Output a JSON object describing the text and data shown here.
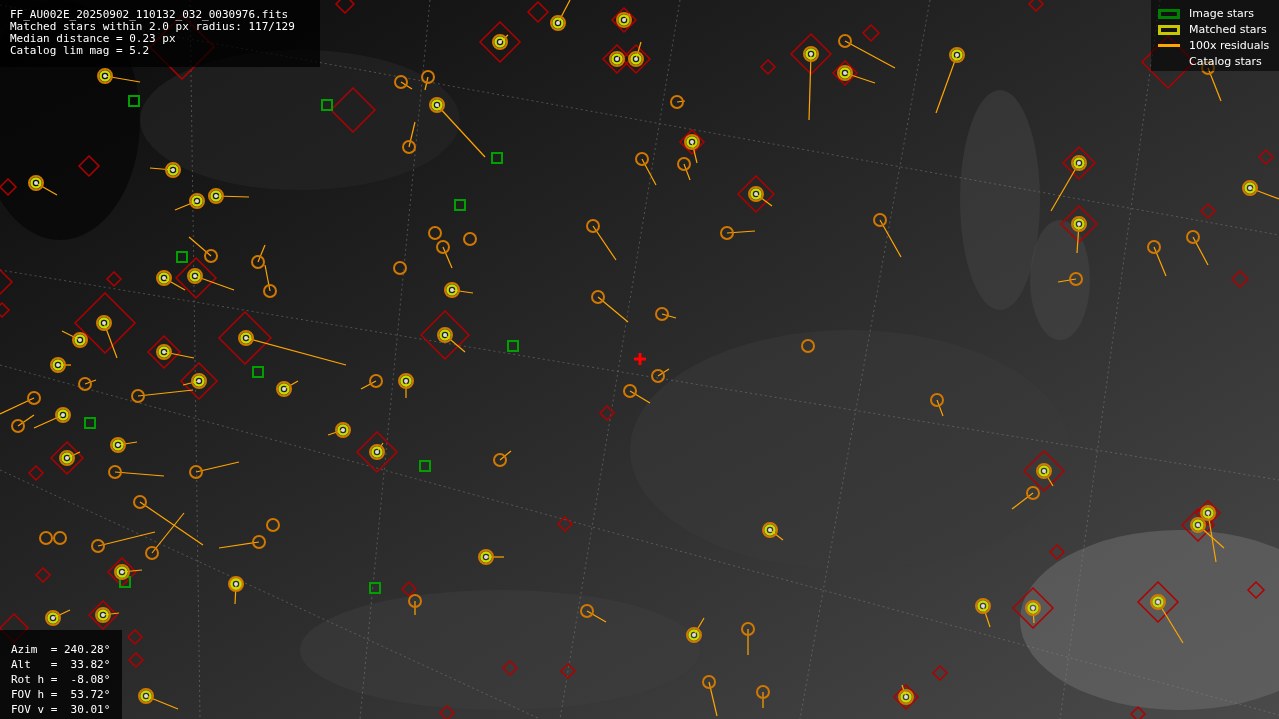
{
  "info_panel": {
    "lines": [
      "FF_AU002E_20250902_110132_032_0030976.fits",
      "Matched stars within 2.0 px radius: 117/129",
      "Median distance = 0.23 px",
      "Catalog lim mag = 5.2"
    ]
  },
  "legend": [
    {
      "kind": "box",
      "color": "#008000",
      "label": "Image stars"
    },
    {
      "kind": "box",
      "color": "#c8c800",
      "label": "Matched stars"
    },
    {
      "kind": "line",
      "color": "#ffa500",
      "label": "100x residuals"
    },
    {
      "kind": "none",
      "label": "Catalog stars"
    }
  ],
  "pointing_panel": {
    "lines": [
      "Azim  = 240.28°",
      "Alt   =  33.82°",
      "Rot h =  -8.08°",
      "FOV h =  53.72°",
      "FOV v =  30.01°"
    ]
  }
}
